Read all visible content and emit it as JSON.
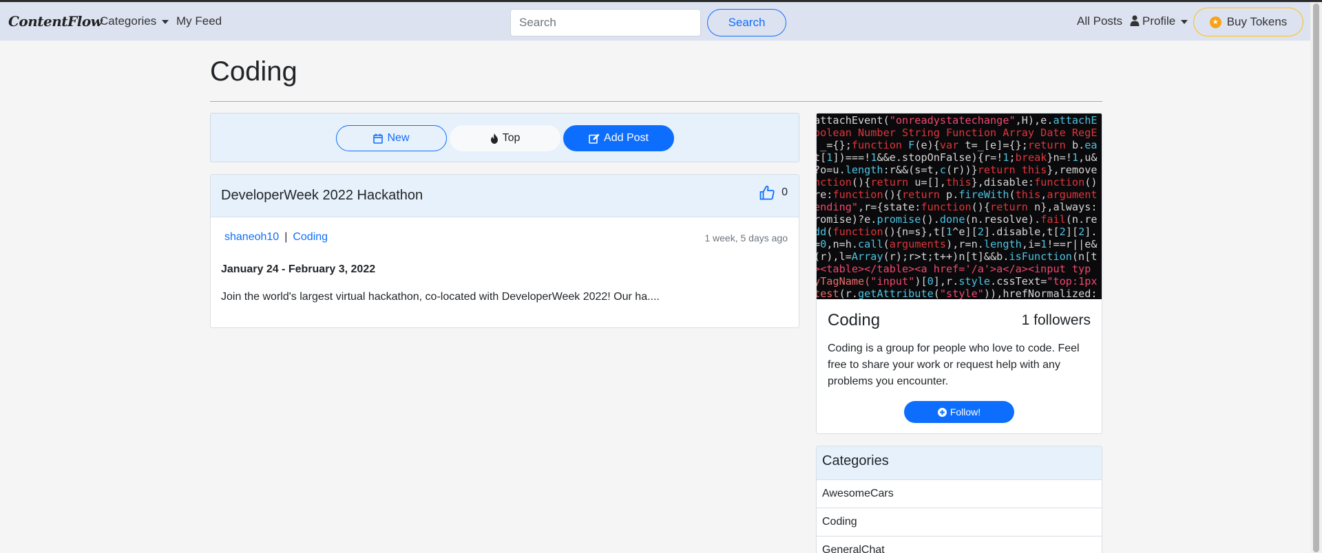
{
  "nav": {
    "brand": "ContentFlow",
    "categories": "Categories",
    "my_feed": "My Feed",
    "search_placeholder": "Search",
    "search_button": "Search",
    "all_posts": "All Posts",
    "profile": "Profile",
    "buy_tokens": "Buy Tokens"
  },
  "page": {
    "title": "Coding"
  },
  "sort": {
    "new": "New",
    "top": "Top",
    "add": "Add Post"
  },
  "post": {
    "title": "DeveloperWeek 2022 Hackathon",
    "likes": "0",
    "author": "shaneoh10",
    "separator": "|",
    "category": "Coding",
    "time": "1 week, 5 days ago",
    "subtitle": "January 24 - February 3, 2022",
    "excerpt": "Join the world's largest virtual hackathon, co-located with DeveloperWeek 2022! Our ha...."
  },
  "group": {
    "name": "Coding",
    "followers": "1 followers",
    "description": "Coding is a group for people who love to code. Feel free to share your work or request help with any problems you encounter.",
    "follow_button": "Follow!"
  },
  "categories": {
    "header": "Categories",
    "items": [
      "AwesomeCars",
      "Coding",
      "GeneralChat"
    ]
  },
  "colors": {
    "primary": "#0d6efd",
    "navbar": "#dde2f1",
    "card_header": "#e7f1fb",
    "token": "#ffc107"
  }
}
